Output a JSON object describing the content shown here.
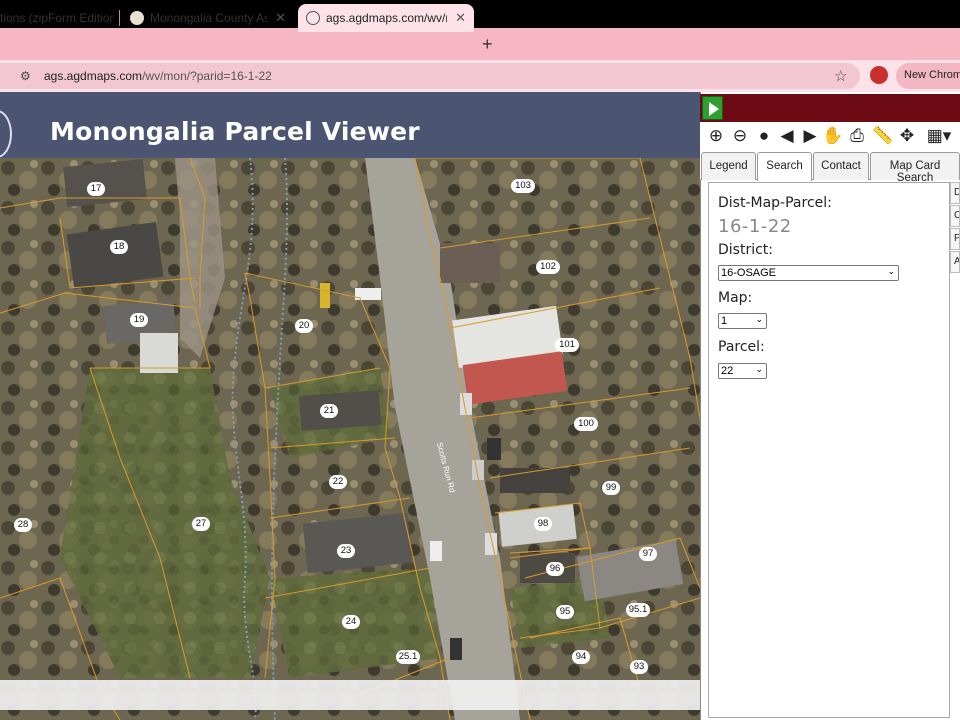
{
  "browser": {
    "tabs": [
      {
        "label": "tions (zipForm Edition",
        "active": false
      },
      {
        "label": "Monongalia County Assessor",
        "active": false
      },
      {
        "label": "ags.agdmaps.com/wv/mon/?p",
        "active": true
      }
    ],
    "new_tab_symbol": "+",
    "url_host": "ags.agdmaps.com",
    "url_path": "/wv/mon/?parid=16-1-22",
    "new_chrome_label": "New Chrome"
  },
  "app": {
    "title": "Monongalia Parcel Viewer"
  },
  "panel": {
    "tabs": [
      "Legend",
      "Search",
      "Contact",
      "Map Card Search"
    ],
    "active_tab": "Search",
    "dmp_label": "Dist-Map-Parcel:",
    "dmp_value": "16-1-22",
    "district_label": "District:",
    "district_value": "16-OSAGE",
    "map_label": "Map:",
    "map_value": "1",
    "parcel_label": "Parcel:",
    "parcel_value": "22",
    "side_tabs": [
      "D",
      "C",
      "P",
      "A"
    ],
    "tools": [
      "zoom-in-icon",
      "zoom-out-icon",
      "globe-icon",
      "back-icon",
      "forward-icon",
      "pan-hand-icon",
      "print-icon",
      "measure-ruler-icon",
      "crosshair-icon",
      "table-icon"
    ]
  },
  "map": {
    "parcel_labels": [
      "17",
      "18",
      "19",
      "20",
      "21",
      "22",
      "23",
      "24",
      "25.1",
      "27",
      "28",
      "93",
      "94",
      "95",
      "95.1",
      "96",
      "97",
      "98",
      "99",
      "100",
      "101",
      "102",
      "103"
    ],
    "road_label": "Scotts Run Rd"
  }
}
